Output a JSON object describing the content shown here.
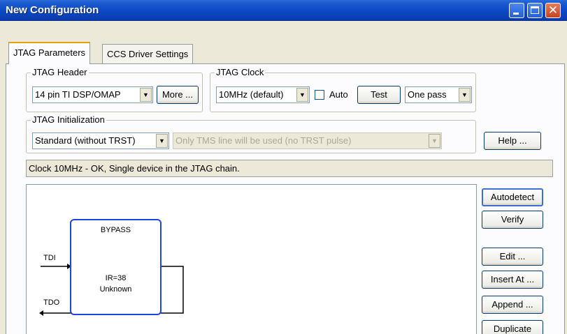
{
  "window": {
    "title": "New Configuration"
  },
  "tabs": [
    {
      "label": "JTAG Parameters",
      "active": true
    },
    {
      "label": "CCS Driver Settings",
      "active": false
    }
  ],
  "jtag_header": {
    "legend": "JTAG Header",
    "selected": "14 pin TI DSP/OMAP",
    "more_button": "More ..."
  },
  "jtag_clock": {
    "legend": "JTAG Clock",
    "selected": "10MHz (default)",
    "auto_label": "Auto",
    "auto_checked": false,
    "test_button": "Test",
    "mode_selected": "One pass"
  },
  "jtag_init": {
    "legend": "JTAG Initialization",
    "selected": "Standard (without TRST)",
    "detail": "Only TMS line will be used (no TRST pulse)"
  },
  "help_button": "Help ...",
  "status_text": "Clock 10MHz - OK, Single device in the JTAG chain.",
  "chain": {
    "device_name": "BYPASS",
    "ir": "IR=38",
    "device_status": "Unknown",
    "tdi_label": "TDI",
    "tdo_label": "TDO"
  },
  "side_buttons": {
    "autodetect": "Autodetect",
    "verify": "Verify",
    "edit": "Edit ...",
    "insert_at": "Insert At ...",
    "append": "Append ...",
    "duplicate": "Duplicate"
  },
  "colors": {
    "titlebar": "#0b4bc6",
    "device_border": "#2044e0",
    "active_tab_accent": "#e8a202"
  }
}
